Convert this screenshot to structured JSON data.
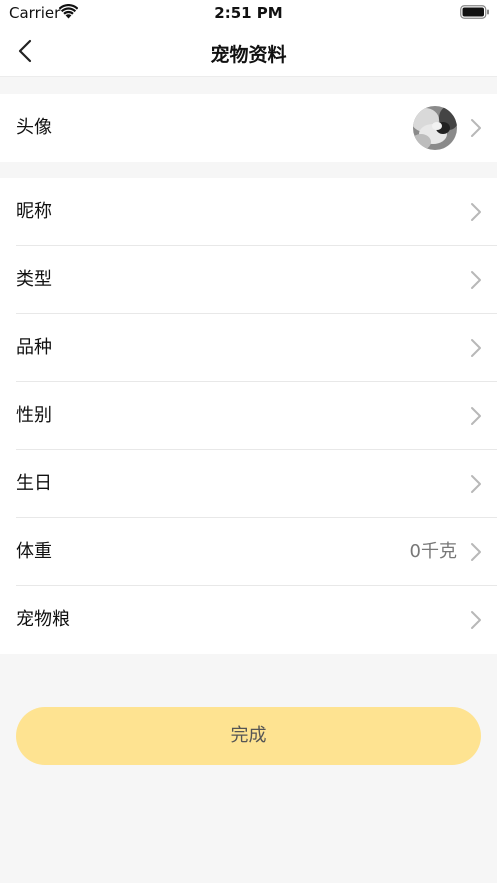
{
  "status_bar": {
    "carrier": "Carrier",
    "time": "2:51 PM"
  },
  "nav": {
    "title": "宠物资料",
    "back_icon": "chevron-left-icon"
  },
  "avatar_row": {
    "label": "头像"
  },
  "rows": [
    {
      "label": "昵称",
      "value": ""
    },
    {
      "label": "类型",
      "value": ""
    },
    {
      "label": "品种",
      "value": ""
    },
    {
      "label": "性别",
      "value": ""
    },
    {
      "label": "生日",
      "value": ""
    },
    {
      "label": "体重",
      "value": "0千克"
    },
    {
      "label": "宠物粮",
      "value": ""
    }
  ],
  "done_button": {
    "label": "完成"
  },
  "colors": {
    "accent": "#fee391",
    "background": "#f6f6f6"
  }
}
